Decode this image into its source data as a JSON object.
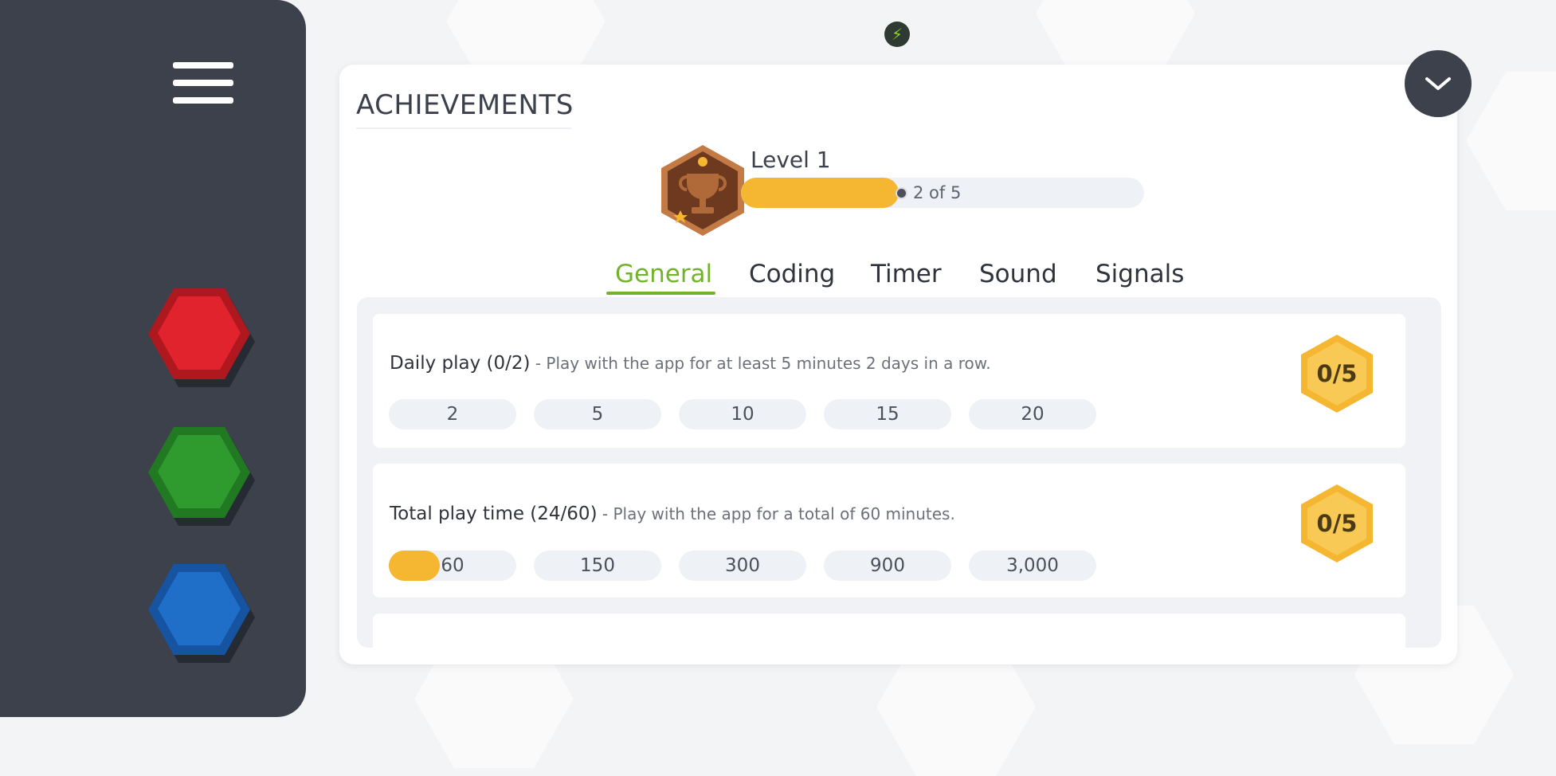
{
  "colors": {
    "sidebar_bg": "#3d414c",
    "accent_green": "#73b32b",
    "progress_gold": "#f5b731",
    "hex_red": "#e0232c",
    "hex_green": "#2f9a2e",
    "hex_blue": "#1f6fc9"
  },
  "sidebar": {
    "menu_icon": "hamburger-icon",
    "colors": [
      {
        "name": "red",
        "icon": "red-hexagon-button"
      },
      {
        "name": "green",
        "icon": "green-hexagon-button"
      },
      {
        "name": "blue",
        "icon": "blue-hexagon-button"
      }
    ]
  },
  "status": {
    "energy_icon": "lightning-icon",
    "energy_glyph": "⚡"
  },
  "panel": {
    "title": "ACHIEVEMENTS",
    "collapse_icon": "chevron-down-icon",
    "level": {
      "label": "Level 1",
      "progress_text": "2 of 5",
      "progress_current": 2,
      "progress_total": 5,
      "badge_icon": "trophy-icon"
    },
    "tabs": [
      {
        "label": "General",
        "active": true
      },
      {
        "label": "Coding",
        "active": false
      },
      {
        "label": "Timer",
        "active": false
      },
      {
        "label": "Sound",
        "active": false
      },
      {
        "label": "Signals",
        "active": false
      }
    ],
    "achievements": [
      {
        "title": "Daily play (0/2)",
        "description": " - Play with the app for at least 5 minutes 2 days in a row.",
        "milestones": [
          "2",
          "5",
          "10",
          "15",
          "20"
        ],
        "first_milestone_progress": 0,
        "badge": "0/5"
      },
      {
        "title": "Total play time (24/60)",
        "description": " - Play with the app for a total of 60 minutes.",
        "milestones": [
          "60",
          "150",
          "300",
          "900",
          "3,000"
        ],
        "first_milestone_progress": 0.4,
        "badge": "0/5"
      }
    ]
  }
}
